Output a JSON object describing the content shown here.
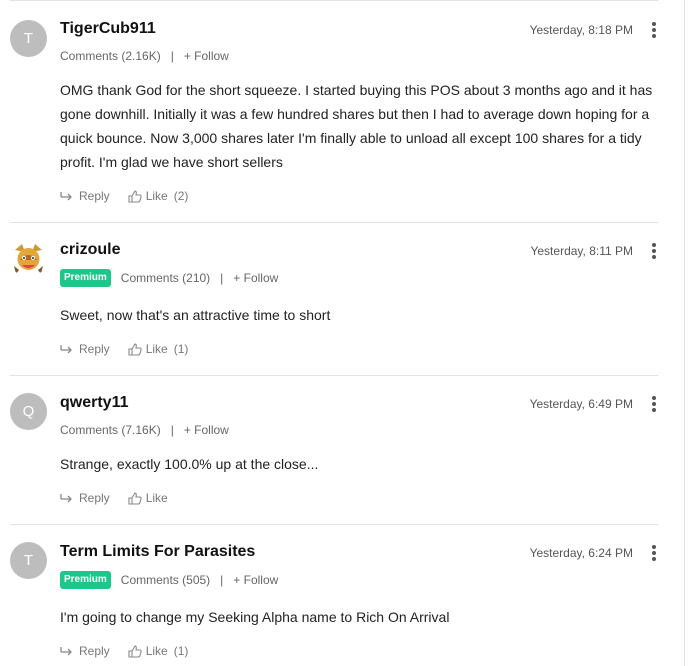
{
  "comments": [
    {
      "avatar_letter": "T",
      "username": "TigerCub911",
      "premium": false,
      "comments_label": "Comments (2.16K)",
      "separator": "|",
      "follow_label": "+ Follow",
      "time": "Yesterday, 8:18 PM",
      "body": "OMG thank God for the short squeeze. I started buying this POS about 3 months ago and it has gone downhill. Initially it was a few hundred shares but then I had to average down hoping for a quick bounce. Now 3,000 shares later I'm finally able to unload all except 100 shares for a tidy profit. I'm glad we have short sellers",
      "reply_label": "Reply",
      "like_label": "Like",
      "like_count": "(2)"
    },
    {
      "avatar_letter": "",
      "username": "crizoule",
      "premium": true,
      "premium_label": "Premium",
      "comments_label": "Comments (210)",
      "separator": "|",
      "follow_label": "+ Follow",
      "time": "Yesterday, 8:11 PM",
      "body": "Sweet, now that's an attractive time to short",
      "reply_label": "Reply",
      "like_label": "Like",
      "like_count": "(1)"
    },
    {
      "avatar_letter": "Q",
      "username": "qwerty11",
      "premium": false,
      "comments_label": "Comments (7.16K)",
      "separator": "|",
      "follow_label": "+ Follow",
      "time": "Yesterday, 6:49 PM",
      "body": "Strange, exactly 100.0% up at the close...",
      "reply_label": "Reply",
      "like_label": "Like",
      "like_count": ""
    },
    {
      "avatar_letter": "T",
      "username": "Term Limits For Parasites",
      "premium": true,
      "premium_label": "Premium",
      "comments_label": "Comments (505)",
      "separator": "|",
      "follow_label": "+ Follow",
      "time": "Yesterday, 6:24 PM",
      "body": "I'm going to change my Seeking Alpha name to Rich On Arrival",
      "reply_label": "Reply",
      "like_label": "Like",
      "like_count": "(1)"
    }
  ],
  "colors": {
    "premium_badge": "#1cc889",
    "avatar_gray": "#bdbdbd",
    "divider": "#e3e3e3"
  },
  "icons": {
    "reply": "reply-arrow-icon",
    "like": "thumbs-up-icon",
    "more": "more-vertical-icon"
  }
}
